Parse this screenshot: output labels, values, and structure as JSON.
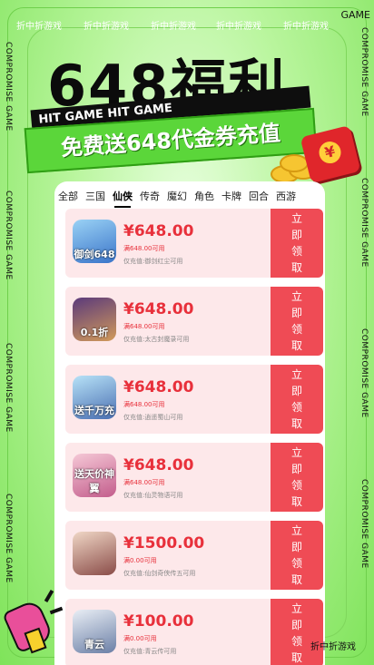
{
  "header": {
    "promo_tag": "折中折游戏",
    "corner_label": "GAME",
    "side_label": "COMPROMISE GAME",
    "headline": "648福利",
    "ribbon_dark": "HIT GAME  HIT GAME",
    "ribbon_green": "免费送648代金券充值"
  },
  "tabs": [
    "全部",
    "三国",
    "仙侠",
    "传奇",
    "魔幻",
    "角色",
    "卡牌",
    "回合",
    "西游"
  ],
  "active_tab": "仙侠",
  "claim_label": [
    "立",
    "即",
    "领",
    "取"
  ],
  "cards": [
    {
      "price": "¥648.00",
      "condition": "满648.00可用",
      "limit": "仅充值:御剑红尘可用",
      "icon_caption": "御剑648",
      "icon_colors": [
        "#9ad2f5",
        "#3a74c9"
      ]
    },
    {
      "price": "¥648.00",
      "condition": "满648.00可用",
      "limit": "仅充值:太古封魔录可用",
      "icon_caption": "0.1折",
      "icon_colors": [
        "#5b3a7b",
        "#d29a5a"
      ]
    },
    {
      "price": "¥648.00",
      "condition": "满648.00可用",
      "limit": "仅充值:逍遥蜀山可用",
      "icon_caption": "送千万充",
      "icon_colors": [
        "#b7e2f7",
        "#4a6fb2"
      ]
    },
    {
      "price": "¥648.00",
      "condition": "满648.00可用",
      "limit": "仅充值:仙灵物语可用",
      "icon_caption": "送天价神翼",
      "icon_colors": [
        "#f5c8d6",
        "#c35d8c"
      ]
    },
    {
      "price": "¥1500.00",
      "condition": "满0.00可用",
      "limit": "仅充值:仙剑奇侠传五可用",
      "icon_caption": "",
      "icon_colors": [
        "#f0d7c6",
        "#8a4c48"
      ]
    },
    {
      "price": "¥100.00",
      "condition": "满0.00可用",
      "limit": "仅充值:青云传可用",
      "icon_caption": "青云",
      "icon_colors": [
        "#e9eef5",
        "#6b7fa6"
      ]
    }
  ],
  "colors": {
    "accent_red": "#ef4b55",
    "price_red": "#e8303b",
    "card_bg": "#fde8ea",
    "green": "#5bd63a"
  }
}
